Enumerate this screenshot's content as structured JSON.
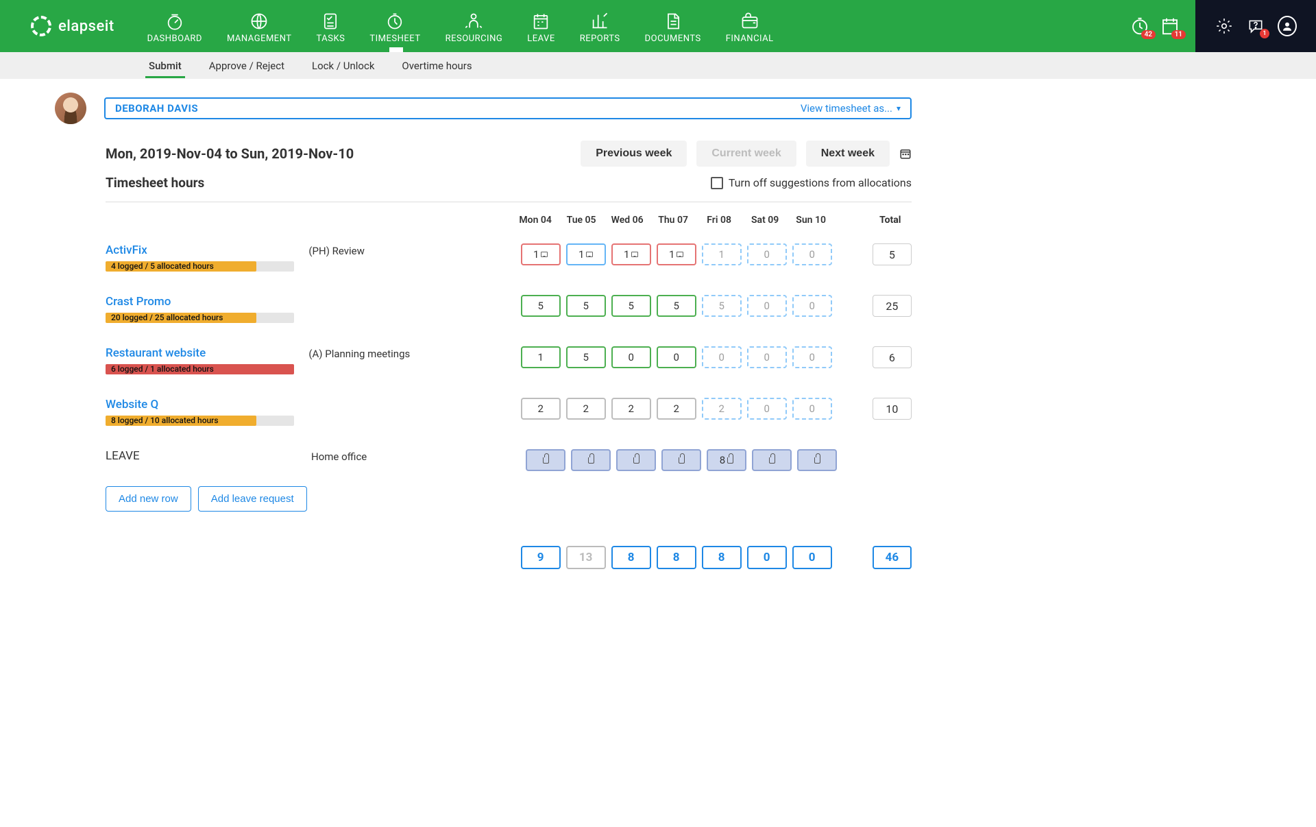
{
  "brand": "elapseit",
  "nav": {
    "items": [
      {
        "label": "DASHBOARD"
      },
      {
        "label": "MANAGEMENT"
      },
      {
        "label": "TASKS"
      },
      {
        "label": "TIMESHEET"
      },
      {
        "label": "RESOURCING"
      },
      {
        "label": "LEAVE"
      },
      {
        "label": "REPORTS"
      },
      {
        "label": "DOCUMENTS"
      },
      {
        "label": "FINANCIAL"
      }
    ]
  },
  "badges": {
    "timer": "42",
    "calendar": "11",
    "chat": "1"
  },
  "subnav": {
    "items": [
      {
        "label": "Submit"
      },
      {
        "label": "Approve / Reject"
      },
      {
        "label": "Lock / Unlock"
      },
      {
        "label": "Overtime hours"
      }
    ]
  },
  "user": {
    "name": "DEBORAH DAVIS",
    "view_as": "View timesheet as..."
  },
  "date_range": "Mon, 2019-Nov-04 to Sun, 2019-Nov-10",
  "week_nav": {
    "prev": "Previous week",
    "current": "Current week",
    "next": "Next week"
  },
  "section_title": "Timesheet hours",
  "toggle_label": "Turn off suggestions from allocations",
  "days": [
    "Mon 04",
    "Tue 05",
    "Wed 06",
    "Thu 07",
    "Fri 08",
    "Sat 09",
    "Sun 10"
  ],
  "total_label": "Total",
  "rows": [
    {
      "project": "ActivFix",
      "task": "(PH) Review",
      "progress_text": "4 logged / 5 allocated hours",
      "progress_pct": 80,
      "bar": "orange",
      "cells": [
        {
          "v": "1",
          "style": "red",
          "comment": true
        },
        {
          "v": "1",
          "style": "blue",
          "comment": true
        },
        {
          "v": "1",
          "style": "red",
          "comment": true
        },
        {
          "v": "1",
          "style": "red",
          "comment": true
        },
        {
          "v": "1",
          "style": "dashed"
        },
        {
          "v": "0",
          "style": "dashed"
        },
        {
          "v": "0",
          "style": "dashed"
        }
      ],
      "total": "5"
    },
    {
      "project": "Crast Promo",
      "task": "",
      "progress_text": "20 logged / 25 allocated hours",
      "progress_pct": 80,
      "bar": "orange",
      "cells": [
        {
          "v": "5",
          "style": "green"
        },
        {
          "v": "5",
          "style": "green"
        },
        {
          "v": "5",
          "style": "green"
        },
        {
          "v": "5",
          "style": "green"
        },
        {
          "v": "5",
          "style": "dashed"
        },
        {
          "v": "0",
          "style": "dashed"
        },
        {
          "v": "0",
          "style": "dashed"
        }
      ],
      "total": "25"
    },
    {
      "project": "Restaurant website",
      "task": "(A) Planning meetings",
      "progress_text": "6 logged / 1 allocated hours",
      "progress_pct": 100,
      "bar": "red",
      "cells": [
        {
          "v": "1",
          "style": "green"
        },
        {
          "v": "5",
          "style": "green"
        },
        {
          "v": "0",
          "style": "green"
        },
        {
          "v": "0",
          "style": "green"
        },
        {
          "v": "0",
          "style": "dashed"
        },
        {
          "v": "0",
          "style": "dashed"
        },
        {
          "v": "0",
          "style": "dashed"
        }
      ],
      "total": "6"
    },
    {
      "project": "Website Q",
      "task": "",
      "progress_text": "8 logged / 10 allocated hours",
      "progress_pct": 80,
      "bar": "orange",
      "cells": [
        {
          "v": "2",
          "style": "gray"
        },
        {
          "v": "2",
          "style": "gray"
        },
        {
          "v": "2",
          "style": "gray"
        },
        {
          "v": "2",
          "style": "gray"
        },
        {
          "v": "2",
          "style": "dashed"
        },
        {
          "v": "0",
          "style": "dashed"
        },
        {
          "v": "0",
          "style": "dashed"
        }
      ],
      "total": "10"
    }
  ],
  "leave": {
    "label": "LEAVE",
    "task": "Home office",
    "cells": [
      {
        "v": "",
        "style": "leave",
        "lock": true
      },
      {
        "v": "",
        "style": "leave",
        "lock": true
      },
      {
        "v": "",
        "style": "leave",
        "lock": true
      },
      {
        "v": "",
        "style": "leave",
        "lock": true
      },
      {
        "v": "8",
        "style": "leave",
        "lock": true
      },
      {
        "v": "",
        "style": "leave",
        "lock": true
      },
      {
        "v": "",
        "style": "leave",
        "lock": true
      }
    ]
  },
  "buttons": {
    "add_row": "Add new row",
    "add_leave": "Add leave request"
  },
  "day_totals": [
    "9",
    "13",
    "8",
    "8",
    "8",
    "0",
    "0"
  ],
  "day_totals_muted_index": 1,
  "grand_total": "46"
}
